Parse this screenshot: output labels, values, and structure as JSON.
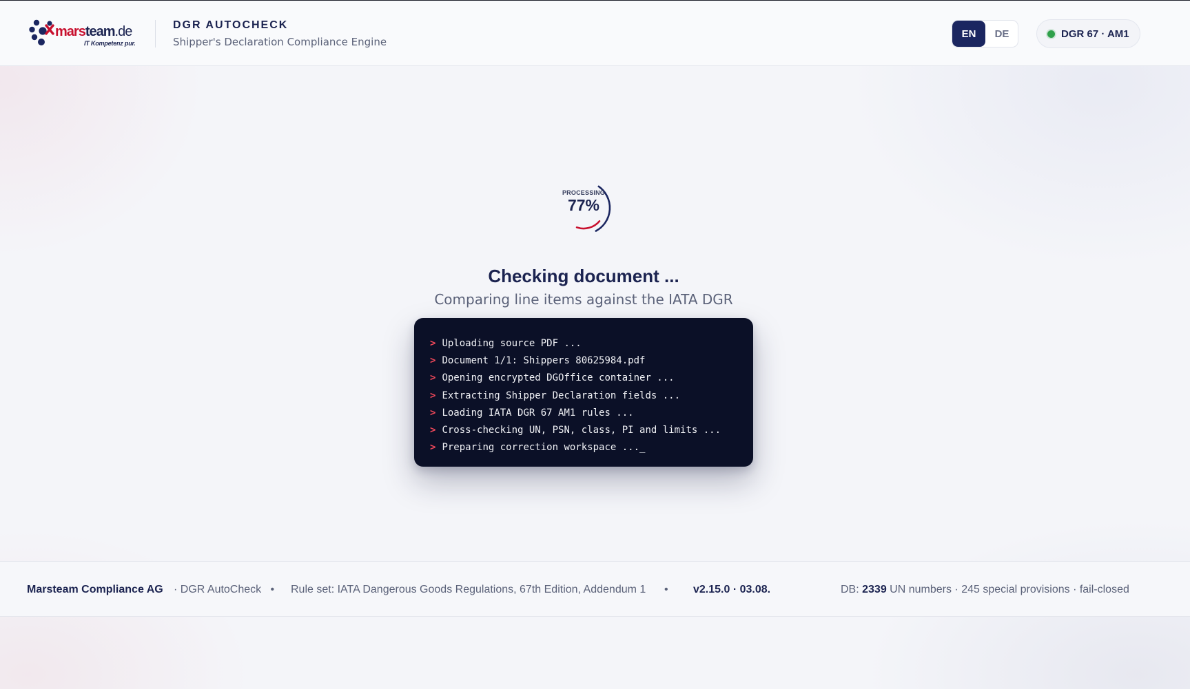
{
  "header": {
    "logo": {
      "brand_a": "mars",
      "brand_b": "team",
      "brand_tld": ".de",
      "tagline": "IT Kompetenz pur."
    },
    "title": "DGR AUTOCHECK",
    "subtitle": "Shipper's Declaration Compliance Engine",
    "languages": [
      {
        "label": "EN",
        "active": true
      },
      {
        "label": "DE",
        "active": false
      }
    ],
    "version_badge": "DGR 67 · AM1",
    "status_color": "#2fa04a"
  },
  "progress": {
    "label": "PROCESSING",
    "value_text": "77%",
    "fraction": 0.77,
    "colors": {
      "outer": "#1b2660",
      "inner": "#c8102e"
    }
  },
  "main": {
    "title": "Checking document ...",
    "subtitle": "Comparing line items against the IATA DGR"
  },
  "terminal": {
    "prompt": ">",
    "lines": [
      "Uploading source PDF ...",
      "Document 1/1: Shippers 80625984.pdf",
      "Opening encrypted DGOffice container ...",
      "Extracting Shipper Declaration fields ...",
      "Loading IATA DGR 67 AM1 rules ...",
      "Cross-checking UN, PSN, class, PI and limits ...",
      "Preparing correction workspace ..._"
    ]
  },
  "footer": {
    "company": "Marsteam Compliance AG",
    "product": "· DGR AutoCheck",
    "bullet": "•",
    "ruleset": "Rule set: IATA Dangerous Goods Regulations, 67th Edition, Addendum 1",
    "version": "v2.15.0 · 03.08.",
    "db_prefix": "DB:",
    "db_count": "2339",
    "db_suffix": "UN numbers · 245 special provisions · fail-closed"
  }
}
